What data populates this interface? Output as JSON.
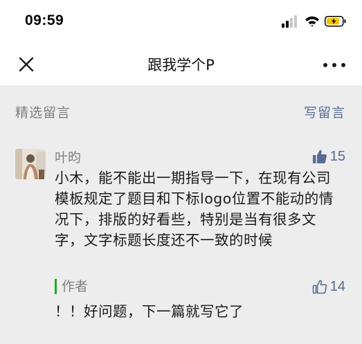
{
  "status_bar": {
    "time": "09:59"
  },
  "nav": {
    "title": "跟我学个P"
  },
  "section": {
    "title": "精选留言",
    "write_label": "写留言"
  },
  "comment": {
    "author": "叶昀",
    "likes": "15",
    "text": "小木，能不能出一期指导一下，在现有公司模板规定了题目和下标logo位置不能动的情况下，排版的好看些，特别是当有很多文字，文字标题长度还不一致的时候"
  },
  "reply": {
    "author": "作者",
    "likes": "14",
    "text": "！！好问题，下一篇就写它了"
  },
  "colors": {
    "link": "#576b95",
    "author_bar": "#1aad19",
    "battery": "#f5c400"
  }
}
